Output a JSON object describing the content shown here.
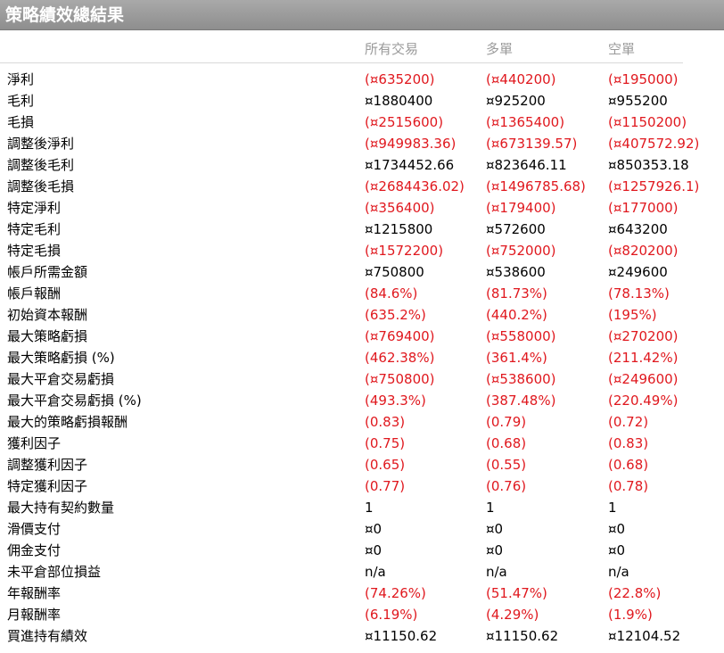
{
  "title": "策略績效總結果",
  "columns": [
    "所有交易",
    "多單",
    "空單"
  ],
  "colors": {
    "negative": "#e0181e",
    "positive": "#000000",
    "header_text": "#9a9a9a",
    "titlebar": "#999999"
  },
  "rows": [
    {
      "label": "淨利",
      "values": [
        "(¤635200)",
        "(¤440200)",
        "(¤195000)"
      ],
      "negative": true
    },
    {
      "label": "毛利",
      "values": [
        "¤1880400",
        "¤925200",
        "¤955200"
      ],
      "negative": false
    },
    {
      "label": "毛損",
      "values": [
        "(¤2515600)",
        "(¤1365400)",
        "(¤1150200)"
      ],
      "negative": true
    },
    {
      "label": "調整後淨利",
      "values": [
        "(¤949983.36)",
        "(¤673139.57)",
        "(¤407572.92)"
      ],
      "negative": true
    },
    {
      "label": "調整後毛利",
      "values": [
        "¤1734452.66",
        "¤823646.11",
        "¤850353.18"
      ],
      "negative": false
    },
    {
      "label": "調整後毛損",
      "values": [
        "(¤2684436.02)",
        "(¤1496785.68)",
        "(¤1257926.1)"
      ],
      "negative": true
    },
    {
      "label": "特定淨利",
      "values": [
        "(¤356400)",
        "(¤179400)",
        "(¤177000)"
      ],
      "negative": true
    },
    {
      "label": "特定毛利",
      "values": [
        "¤1215800",
        "¤572600",
        "¤643200"
      ],
      "negative": false
    },
    {
      "label": "特定毛損",
      "values": [
        "(¤1572200)",
        "(¤752000)",
        "(¤820200)"
      ],
      "negative": true
    },
    {
      "label": "帳戶所需金額",
      "values": [
        "¤750800",
        "¤538600",
        "¤249600"
      ],
      "negative": false
    },
    {
      "label": "帳戶報酬",
      "values": [
        "(84.6%)",
        "(81.73%)",
        "(78.13%)"
      ],
      "negative": true
    },
    {
      "label": "初始資本報酬",
      "values": [
        "(635.2%)",
        "(440.2%)",
        "(195%)"
      ],
      "negative": true
    },
    {
      "label": "最大策略虧損",
      "values": [
        "(¤769400)",
        "(¤558000)",
        "(¤270200)"
      ],
      "negative": true
    },
    {
      "label": "最大策略虧損 (%)",
      "values": [
        "(462.38%)",
        "(361.4%)",
        "(211.42%)"
      ],
      "negative": true
    },
    {
      "label": "最大平倉交易虧損",
      "values": [
        "(¤750800)",
        "(¤538600)",
        "(¤249600)"
      ],
      "negative": true
    },
    {
      "label": "最大平倉交易虧損 (%)",
      "values": [
        "(493.3%)",
        "(387.48%)",
        "(220.49%)"
      ],
      "negative": true
    },
    {
      "label": "最大的策略虧損報酬",
      "values": [
        "(0.83)",
        "(0.79)",
        "(0.72)"
      ],
      "negative": true
    },
    {
      "label": "獲利因子",
      "values": [
        "(0.75)",
        "(0.68)",
        "(0.83)"
      ],
      "negative": true
    },
    {
      "label": "調整獲利因子",
      "values": [
        "(0.65)",
        "(0.55)",
        "(0.68)"
      ],
      "negative": true
    },
    {
      "label": "特定獲利因子",
      "values": [
        "(0.77)",
        "(0.76)",
        "(0.78)"
      ],
      "negative": true
    },
    {
      "label": "最大持有契約數量",
      "values": [
        "1",
        "1",
        "1"
      ],
      "negative": false
    },
    {
      "label": "滑價支付",
      "values": [
        "¤0",
        "¤0",
        "¤0"
      ],
      "negative": false
    },
    {
      "label": "佣金支付",
      "values": [
        "¤0",
        "¤0",
        "¤0"
      ],
      "negative": false
    },
    {
      "label": "未平倉部位損益",
      "values": [
        "n/a",
        "n/a",
        "n/a"
      ],
      "negative": false
    },
    {
      "label": "年報酬率",
      "values": [
        "(74.26%)",
        "(51.47%)",
        "(22.8%)"
      ],
      "negative": true
    },
    {
      "label": "月報酬率",
      "values": [
        "(6.19%)",
        "(4.29%)",
        "(1.9%)"
      ],
      "negative": true
    },
    {
      "label": "買進持有績效",
      "values": [
        "¤11150.62",
        "¤11150.62",
        "¤12104.52"
      ],
      "negative": false
    }
  ]
}
